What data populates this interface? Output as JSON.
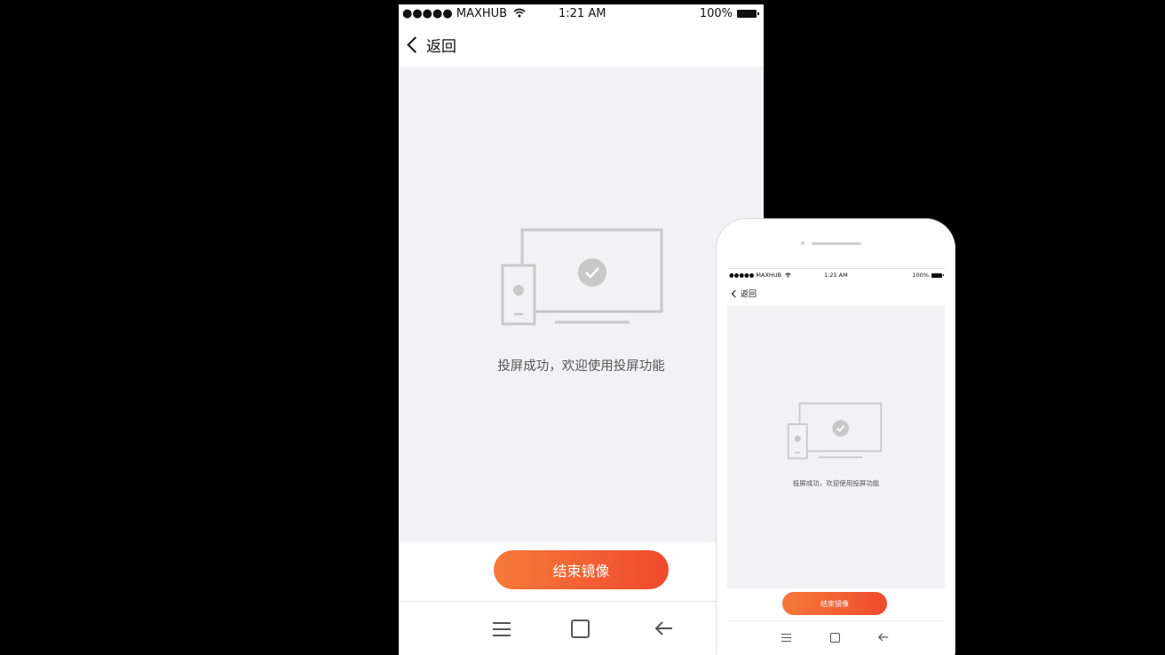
{
  "status_bar": {
    "carrier": "●●●●● MAXHUB",
    "time": "1:21 AM",
    "battery": "100%"
  },
  "nav": {
    "back_label": "返回"
  },
  "main": {
    "message": "投屏成功，欢迎使用投屏功能",
    "end_button_label": "结束镜像"
  },
  "icons": {
    "wifi": "wifi-icon",
    "battery": "battery-icon",
    "back": "chevron-left-icon",
    "illustration": "screen-mirroring-success-illustration",
    "menu": "menu-icon",
    "home": "home-icon",
    "system_back": "arrow-left-icon"
  },
  "colors": {
    "accent_start": "#f67a3a",
    "accent_end": "#ef4a2e",
    "content_bg": "#f2f2f4",
    "illustration_stroke": "#c8c8c8"
  }
}
